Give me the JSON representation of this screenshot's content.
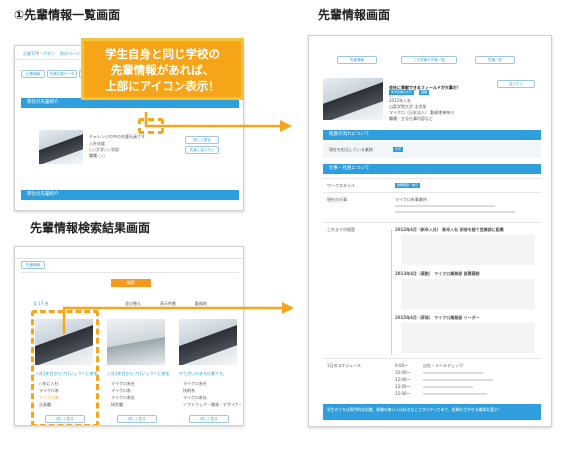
{
  "headings": {
    "list_screen": "①先輩情報一覧画面",
    "detail_screen": "先輩情報画面",
    "search_screen": "先輩情報検索結果画面"
  },
  "callout": {
    "line1": "学生自身と同じ学校の",
    "line2": "先輩情報があれば、",
    "line3": "上部にアイコン表示！"
  },
  "list_screen": {
    "nav_items": [
      "企業TOP・ボタン",
      "前のページへ",
      "先輩情報一覧"
    ],
    "tabs": [
      "企業情報",
      "先輩社員データ",
      "先輩"
    ],
    "section1": "弊社の先輩紹介",
    "section2": "弊社の先輩紹介",
    "card_text": [
      "チャレンジの中の先輩社員です",
      "入社年度",
      "○○大学○○学部",
      "職種 ○○"
    ],
    "card_btn1": "詳しく見る",
    "card_btn2": "先輩に会いたい"
  },
  "search_screen": {
    "tab": "先輩情報",
    "search_btn": "検索",
    "count": "全 17 名",
    "filter_labels": [
      "並び替え",
      "表示件数",
      "勤務地"
    ],
    "cards": [
      {
        "title": "入社1年目からプロジェクトに参加できる やりがいのある仕事です。",
        "fields": [
          "○年に入社",
          "マイクロ系",
          "マイクロ系",
          "企画職"
        ],
        "btn": "詳しく見る"
      },
      {
        "title": "入社1年目からプロジェクトに参加できる やりがいのある仕事です。",
        "fields": [
          "マイクロ系社",
          "マイクロ系",
          "マイクロ系社",
          "研究職"
        ],
        "btn": "詳しく見る"
      },
      {
        "title": "やりがいのある仕事です。",
        "fields": [
          "マイクロ系社",
          "技術系",
          "マイクロ系社",
          "ソフトウェア・開発・デザイナー"
        ],
        "btn": "詳しく見る"
      }
    ]
  },
  "detail_screen": {
    "top_tabs": [
      "先輩情報",
      "この先輩の先輩一覧",
      "先輩一覧"
    ],
    "profile_title": "会社に貢献できるフィールドが大事だ！",
    "profile_lines": [
      "山下 ○○",
      "2012年入社",
      "山梨学院大学 法学部",
      "マイクロ（日本法人） 勤務地神奈川",
      "職種・主な仕事内容など"
    ],
    "follow_btn": "会いたい",
    "section1": "経歴の流れについて",
    "section1_label": "現在を担当している業務",
    "section1_tags": [
      "先輩社員のタグ",
      "職種",
      "タグ"
    ],
    "section2": "仕事・社員について",
    "rows": [
      {
        "label": "ワークスタイル",
        "value": "勤務時間・休日"
      },
      {
        "label": "現在の仕事",
        "value": "マイクロ系事業所"
      },
      {
        "label": "これまでの経歴",
        "value": "2014年4月 入社 新卒入社 研修期間"
      },
      {
        "label": "1日のスケジュール",
        "value": "出社・メールチェック"
      }
    ],
    "timeline": [
      "2012年4月（新卒入社） 新卒入社 研修を経て営業部に配属",
      "2013年4月（異動） マイクロ業務部 部署異動",
      "2015年4月（昇格） マイクロ業務部 リーダー"
    ],
    "schedule": [
      "9:00〜",
      "10:00〜",
      "12:00〜",
      "13:00〜",
      "15:00〜",
      "18:00〜"
    ],
    "footer": "学生のうちは専門的な知識、経験の無い人は好きなことからやってみて、経験を生かせる職場を選ぶ！"
  },
  "colors": {
    "accent_orange": "#f5a61c",
    "blue_bar": "#2e9fdc",
    "callout_text": "#ffffff",
    "callout_bg": "#f6a519"
  }
}
